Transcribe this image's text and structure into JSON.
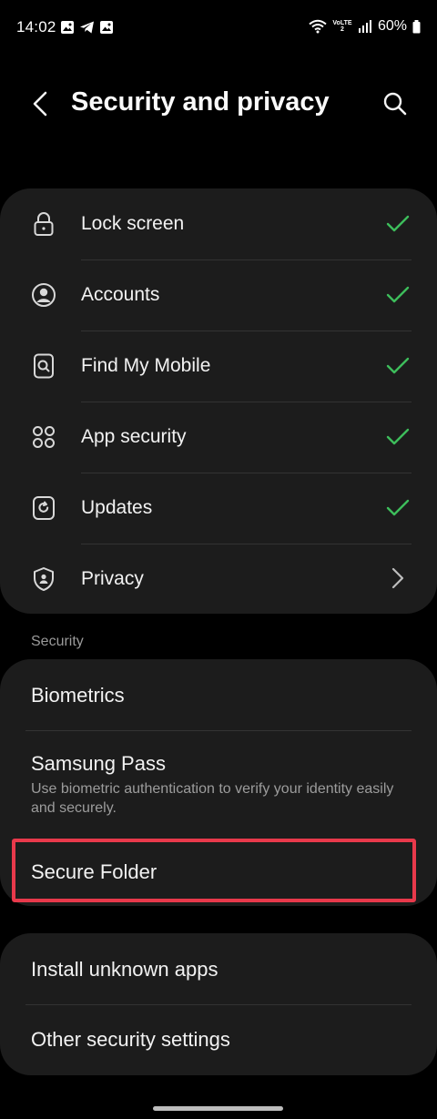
{
  "status_bar": {
    "time": "14:02",
    "volte": "VoLTE2",
    "battery": "60%",
    "notification_icons": [
      "gallery-icon",
      "telegram-icon",
      "gallery-icon"
    ]
  },
  "header": {
    "title": "Security and privacy",
    "back_icon": "back-arrow-icon",
    "search_icon": "search-icon"
  },
  "overview_items": [
    {
      "label": "Lock screen",
      "icon": "lock-icon",
      "trailing": "check"
    },
    {
      "label": "Accounts",
      "icon": "account-icon",
      "trailing": "check"
    },
    {
      "label": "Find My Mobile",
      "icon": "find-my-mobile-icon",
      "trailing": "check"
    },
    {
      "label": "App security",
      "icon": "app-security-icon",
      "trailing": "check"
    },
    {
      "label": "Updates",
      "icon": "updates-icon",
      "trailing": "check"
    },
    {
      "label": "Privacy",
      "icon": "privacy-shield-icon",
      "trailing": "chevron"
    }
  ],
  "security_section": {
    "header": "Security",
    "biometrics": "Biometrics",
    "samsung_pass": {
      "title": "Samsung Pass",
      "description": "Use biometric authentication to verify your identity easily and securely."
    },
    "secure_folder": "Secure Folder"
  },
  "other_section": {
    "install_unknown_apps": "Install unknown apps",
    "other_security_settings": "Other security settings"
  },
  "colors": {
    "background": "#000000",
    "card": "#1c1c1c",
    "check_green": "#3dbd5b",
    "highlight_red": "#e8394b",
    "subtext": "#9c9c9c"
  }
}
